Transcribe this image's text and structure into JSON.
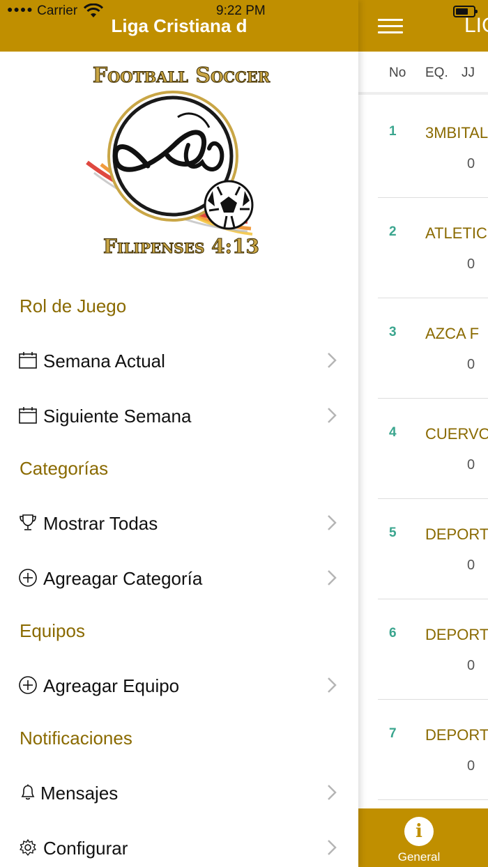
{
  "status_bar": {
    "carrier": "Carrier",
    "time": "9:22 PM"
  },
  "drawer": {
    "title": "Liga Cristiana d",
    "logo": {
      "top_text": "Football Soccer",
      "bottom_text": "Filipenses 4:13"
    },
    "sections": [
      {
        "heading": "Rol de Juego",
        "items": [
          {
            "label": "Semana Actual",
            "icon": "calendar-icon"
          },
          {
            "label": "Siguiente Semana",
            "icon": "calendar-icon"
          }
        ]
      },
      {
        "heading": "Categorías",
        "items": [
          {
            "label": "Mostrar Todas",
            "icon": "trophy-icon"
          },
          {
            "label": "Agreagar Categoría",
            "icon": "plus-circle-icon"
          }
        ]
      },
      {
        "heading": "Equipos",
        "items": [
          {
            "label": "Agreagar Equipo",
            "icon": "plus-circle-icon"
          }
        ]
      },
      {
        "heading": "Notificaciones",
        "items": [
          {
            "label": "Mensajes",
            "icon": "bell-icon"
          },
          {
            "label": "Configurar",
            "icon": "gear-icon"
          }
        ]
      }
    ]
  },
  "main": {
    "title": "LIG",
    "columns": [
      "No",
      "EQ.",
      "JJ"
    ],
    "rows": [
      {
        "no": "1",
        "team": "3MBITAL",
        "value": "0"
      },
      {
        "no": "2",
        "team": "ATLETIC",
        "value": "0"
      },
      {
        "no": "3",
        "team": "AZCA F",
        "value": "0"
      },
      {
        "no": "4",
        "team": "CUERVO",
        "value": "0"
      },
      {
        "no": "5",
        "team": "DEPORT",
        "value": "0"
      },
      {
        "no": "6",
        "team": "DEPORT",
        "value": "0"
      },
      {
        "no": "7",
        "team": "DEPORT",
        "value": "0"
      }
    ],
    "tab": {
      "label": "General",
      "icon": "info-icon",
      "icon_glyph": "i"
    }
  },
  "colors": {
    "accent": "#c08f00",
    "heading_text": "#8a6a00",
    "number_green": "#3aa58e"
  }
}
